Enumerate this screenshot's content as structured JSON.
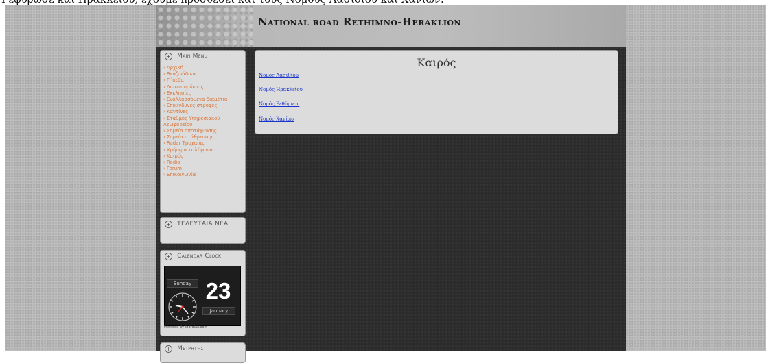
{
  "browser_caption": "Γεφύρωσε και Ηρακλείου, έχουμε προσθέσει και τους Νομούς Λασιθίου και Χανίων.",
  "site": {
    "title": "National road Rethimno-Heraklion"
  },
  "main_menu": {
    "title": "Main Menu",
    "items": [
      "Αρχική",
      "Βενζινάδικα",
      "Γήπεδα",
      "Διασταυρώσεις",
      "Εκκλησίες",
      "Εναλλασσόμενα διαμέτια",
      "Επικίνδυνες στροφές",
      "Καντίνες",
      "Σταθμός Υπηρεσιακού Λεωφορείου",
      "Σημεία αποτάχυνσης",
      "Σημεία στάθμευσης",
      "Radar Τροχαίας",
      "Χρήσιμα τηλέφωνα",
      "Καιρός",
      "Radio",
      "Forum",
      "Επικοινωνία"
    ]
  },
  "latest_news": {
    "title": "ΤΕΛΕΥΤΑΙΑ ΝΕΑ"
  },
  "calendar_clock": {
    "title": "Calendar Clock",
    "day_name": "Sunday",
    "day_number": "23",
    "month": "January",
    "powered_by": "Powered By Ibdrolax.com"
  },
  "next_box": {
    "title": "Μετρητής"
  },
  "content": {
    "heading": "Καιρός",
    "links": [
      "Νομός Λασιθίου",
      "Νομός Ηρακλείου",
      "Νομός Ρεθύμνου",
      "Νομός Χανίων"
    ]
  },
  "colors": {
    "menu_link": "#d9763a",
    "content_link": "#1a35c8",
    "site_background": "#2b2b2b"
  }
}
